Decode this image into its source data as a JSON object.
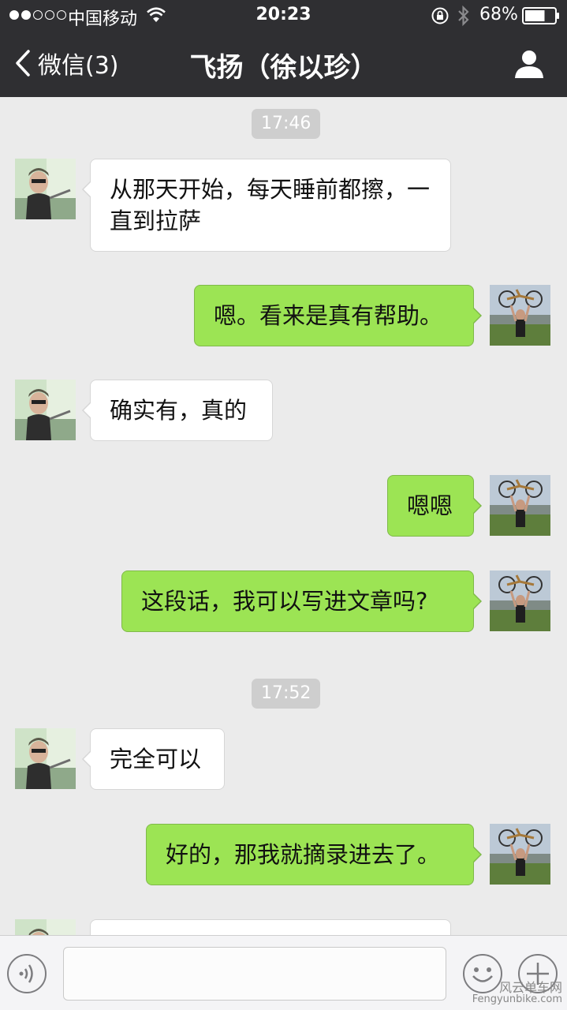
{
  "status_bar": {
    "signal_bars_filled": 2,
    "signal_bars_total": 5,
    "carrier": "中国移动",
    "time": "20:23",
    "battery_percent": "68%",
    "battery_level": 0.68
  },
  "nav": {
    "back_label": "微信(3)",
    "title": "飞扬（徐以珍）"
  },
  "messages": [
    {
      "type": "time",
      "text": "17:46"
    },
    {
      "type": "in",
      "text": "从那天开始，每天睡前都擦，一直到拉萨"
    },
    {
      "type": "out",
      "text": "嗯。看来是真有帮助。"
    },
    {
      "type": "in",
      "text": "确实有，真的"
    },
    {
      "type": "out",
      "text": "嗯嗯"
    },
    {
      "type": "out",
      "text": "这段话，我可以写进文章吗?"
    },
    {
      "type": "time",
      "text": "17:52"
    },
    {
      "type": "in",
      "text": "完全可以"
    },
    {
      "type": "out",
      "text": "好的，那我就摘录进去了。"
    },
    {
      "type": "in",
      "text": ""
    }
  ],
  "input_bar": {
    "value": "",
    "placeholder": ""
  },
  "watermark": {
    "line1": "风云单车网",
    "line2": "Fengyunbike.com"
  },
  "colors": {
    "topbar": "#2f2f32",
    "chat_bg": "#ebebeb",
    "bubble_out": "#9ce454",
    "bubble_in": "#ffffff",
    "time_badge": "#cecece"
  },
  "icons": {
    "back": "chevron-left-icon",
    "profile": "person-icon",
    "voice": "voice-icon",
    "emoji": "smiley-icon",
    "more": "plus-icon",
    "wifi": "wifi-icon",
    "lock": "rotation-lock-icon",
    "bluetooth": "bluetooth-icon",
    "battery": "battery-icon"
  }
}
